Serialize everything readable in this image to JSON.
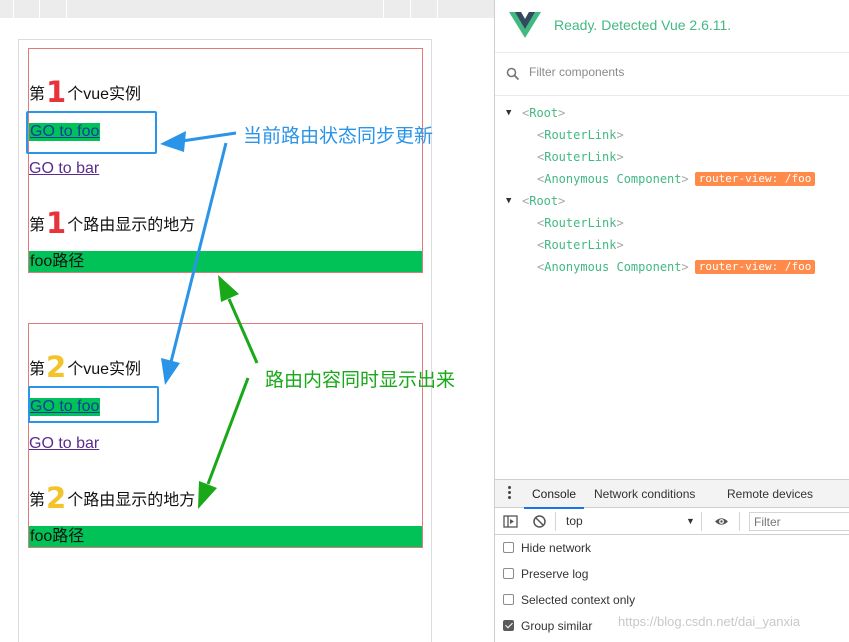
{
  "page": {
    "instances": [
      {
        "heading_pre": "第",
        "heading_num": "1",
        "heading_post": "个vue实例",
        "link_foo": "GO to foo",
        "link_bar": "GO to bar",
        "view_pre": "第",
        "view_num": "1",
        "view_post": "个路由显示的地方",
        "route_content": "foo路径",
        "num_color": "#e8333a"
      },
      {
        "heading_pre": "第",
        "heading_num": "2",
        "heading_post": "个vue实例",
        "link_foo": "GO to foo",
        "link_bar": "GO to bar",
        "view_pre": "第",
        "view_num": "2",
        "view_post": "个路由显示的地方",
        "route_content": "foo路径",
        "num_color": "#f4c22a"
      }
    ],
    "route_view_color": "#00c257"
  },
  "annotations": {
    "sync_update": "当前路由状态同步更新",
    "content_shown": "路由内容同时显示出来",
    "blue": "#2a94e8",
    "green": "#18a818"
  },
  "devtools": {
    "status": "Ready. Detected Vue 2.6.11.",
    "filter_placeholder": "Filter components",
    "tree": [
      {
        "name": "Root",
        "depth": 0,
        "expanded": true
      },
      {
        "name": "RouterLink",
        "depth": 1
      },
      {
        "name": "RouterLink",
        "depth": 1
      },
      {
        "name": "Anonymous Component",
        "depth": 1,
        "badge": "router-view: /foo"
      },
      {
        "name": "Root",
        "depth": 0,
        "expanded": true
      },
      {
        "name": "RouterLink",
        "depth": 1
      },
      {
        "name": "RouterLink",
        "depth": 1
      },
      {
        "name": "Anonymous Component",
        "depth": 1,
        "badge": "router-view: /foo"
      }
    ],
    "accent": "#42b983",
    "badge_color": "#ff8a4a",
    "drawer": {
      "tabs": [
        "Console",
        "Network conditions",
        "Remote devices"
      ],
      "active_tab": "Console",
      "context": "top",
      "filter_placeholder": "Filter",
      "options": [
        {
          "label": "Hide network",
          "checked": false
        },
        {
          "label": "Preserve log",
          "checked": false
        },
        {
          "label": "Selected context only",
          "checked": false
        },
        {
          "label": "Group similar",
          "checked": true
        }
      ]
    }
  },
  "watermark": "https://blog.csdn.net/dai_yanxia"
}
